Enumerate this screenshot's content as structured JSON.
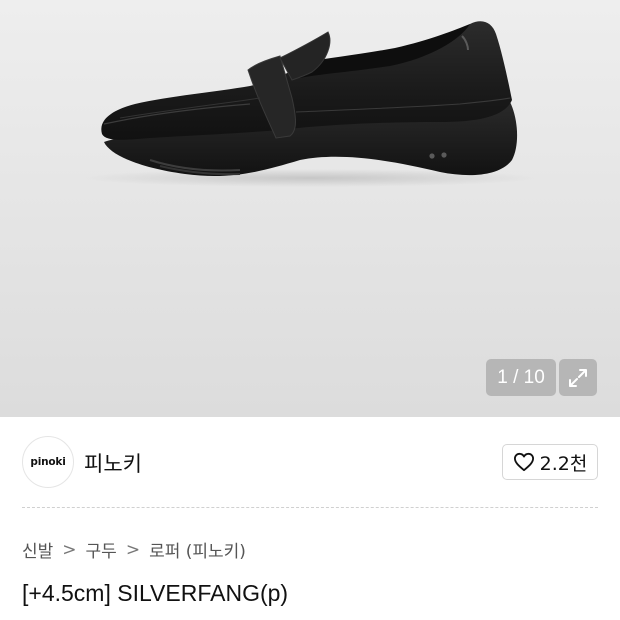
{
  "gallery": {
    "image_counter": "1 / 10",
    "image_alt": "black leather penny loafer"
  },
  "brand": {
    "logo_text": "pinoki",
    "name": "피노키",
    "like_count": "2.2천"
  },
  "breadcrumb": [
    {
      "label": "신발"
    },
    {
      "label": "구두"
    },
    {
      "label": "로퍼 (피노키)"
    }
  ],
  "breadcrumb_separator": ">",
  "product": {
    "title": "[+4.5cm] SILVERFANG(p)"
  },
  "colors": {
    "gallery_bg": "#e6e6e6",
    "shoe": "#1c1c1c",
    "text_primary": "#111111",
    "text_secondary": "#555555"
  }
}
